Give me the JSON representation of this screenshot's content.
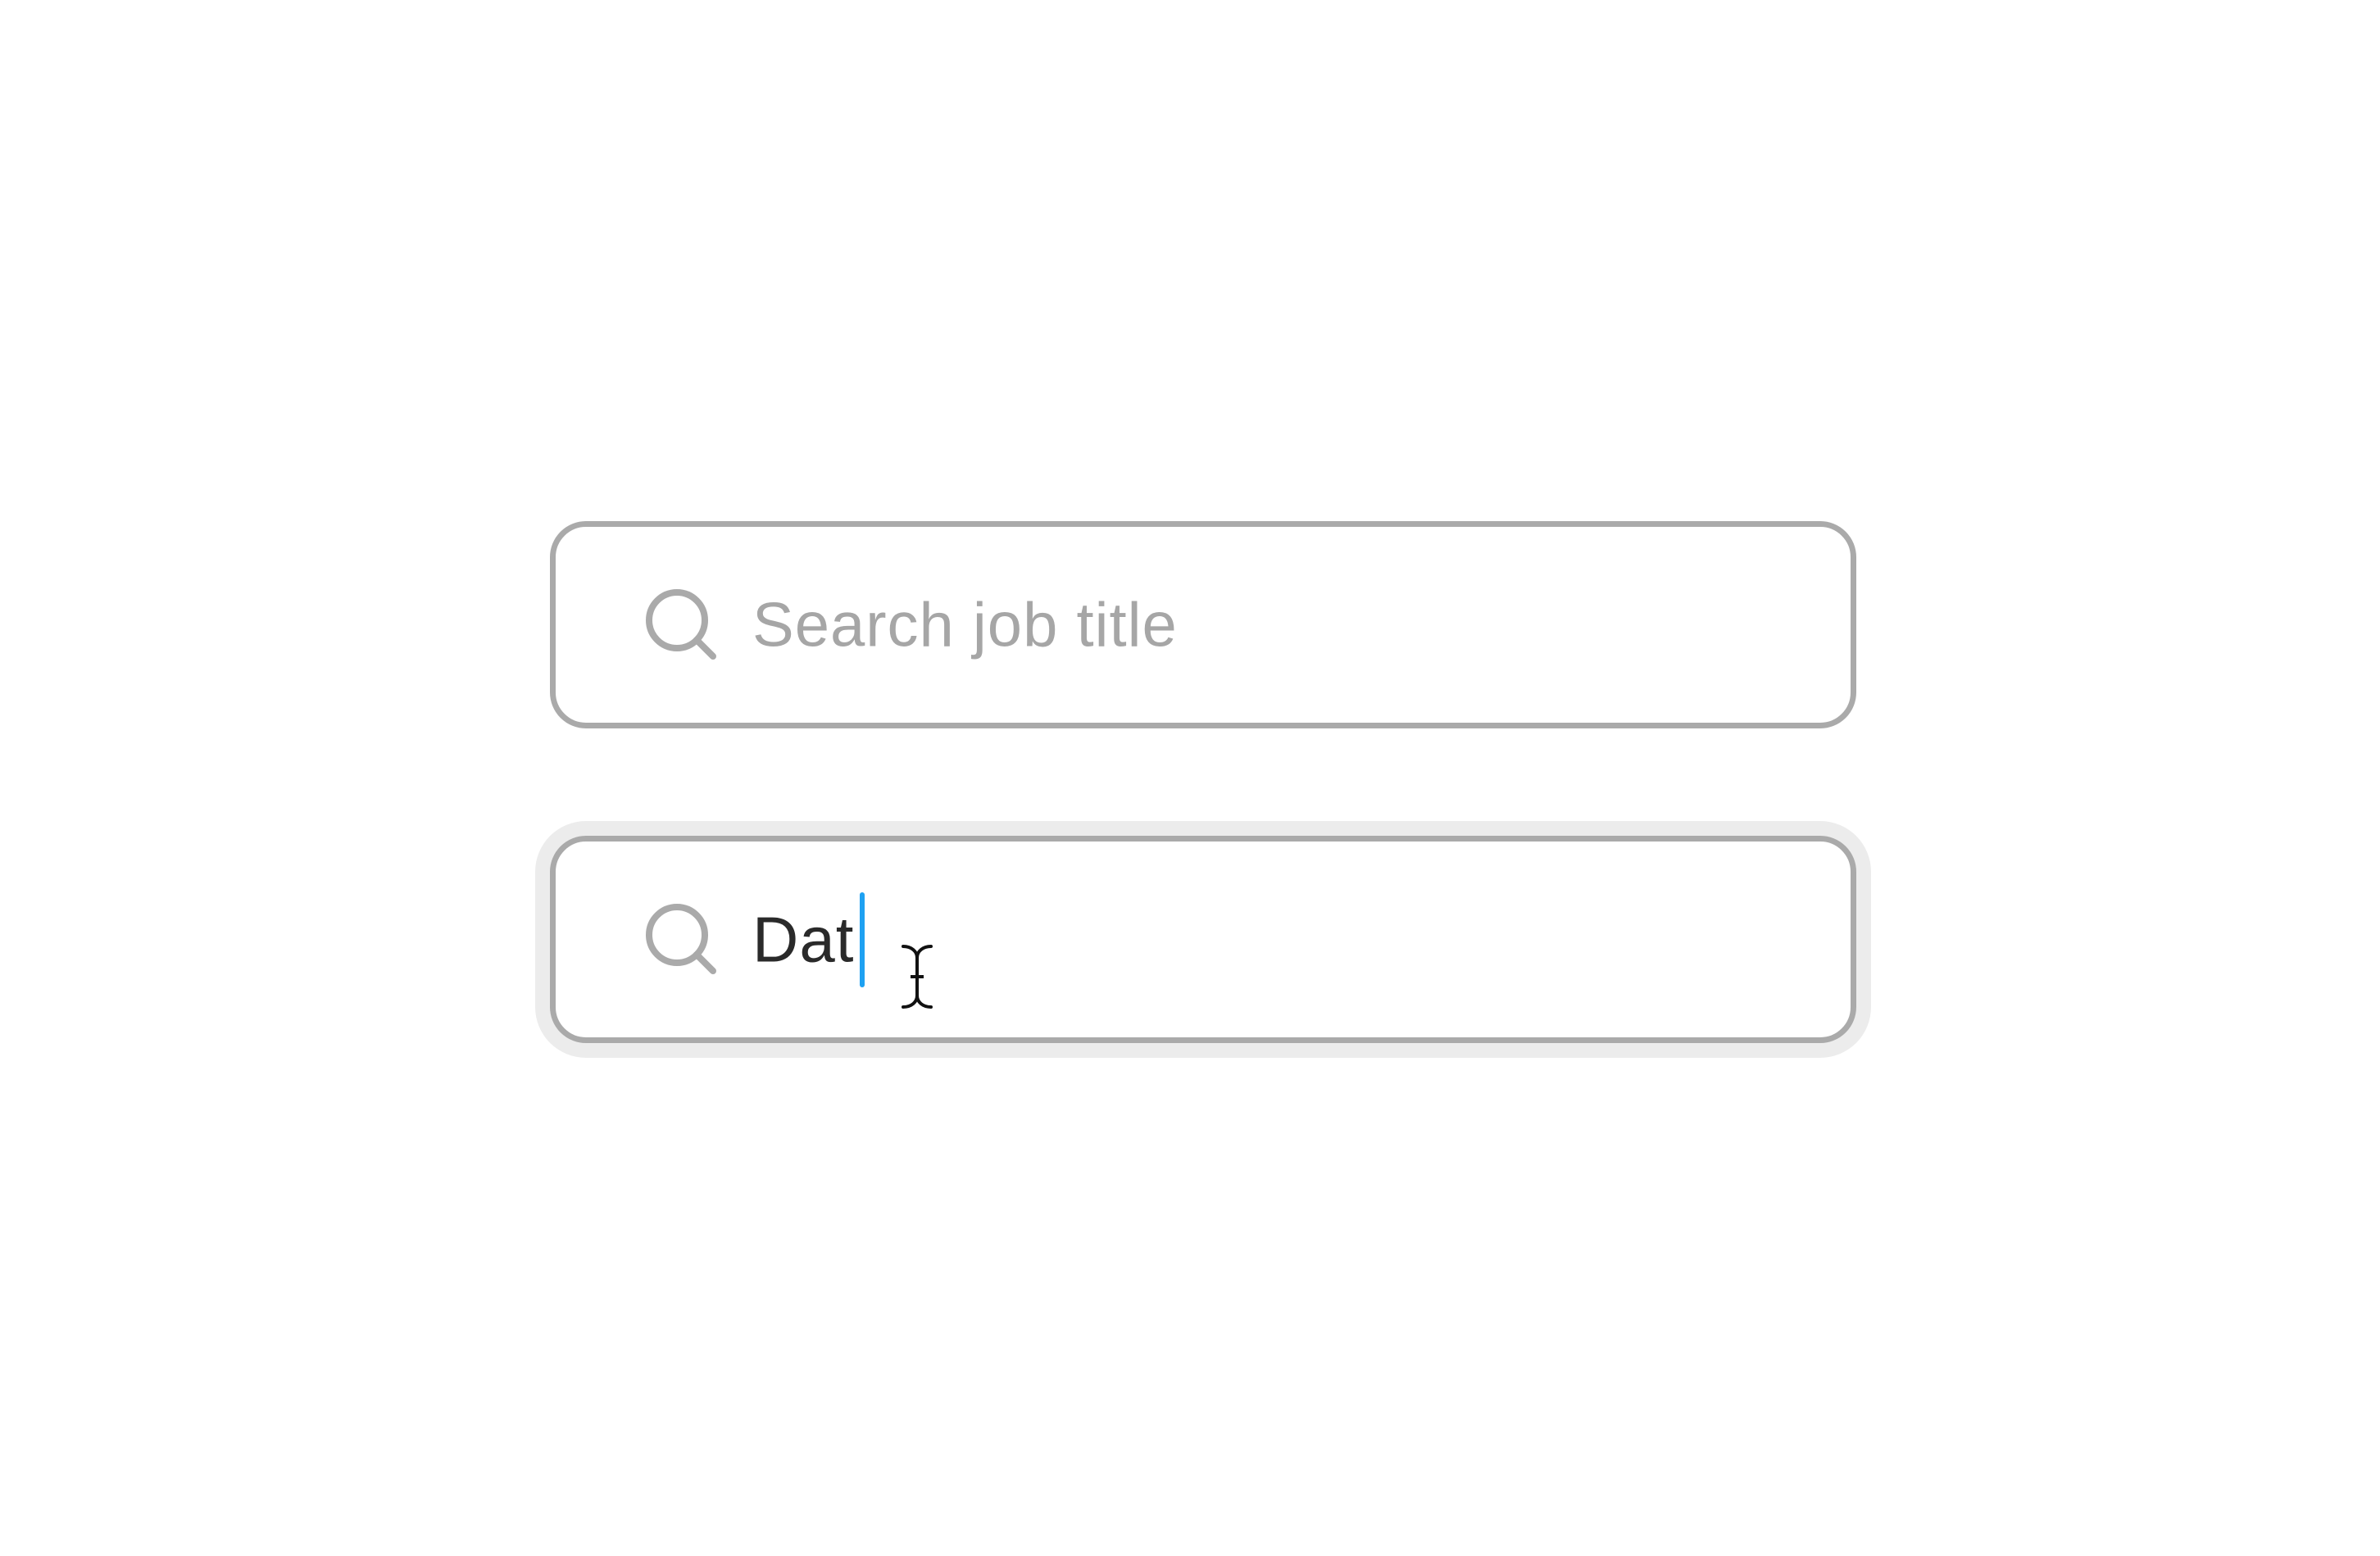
{
  "search_idle": {
    "placeholder": "Search job title",
    "icon": "search-icon"
  },
  "search_focused": {
    "value": "Dat",
    "icon": "search-icon",
    "state": "focused",
    "cursor": "text-cursor-icon"
  },
  "colors": {
    "border": "#aaaaaa",
    "placeholder": "#a6a6a6",
    "text": "#2a2a2a",
    "caret": "#1ea1f2",
    "focus_ring": "#ececec",
    "background": "#ffffff"
  }
}
